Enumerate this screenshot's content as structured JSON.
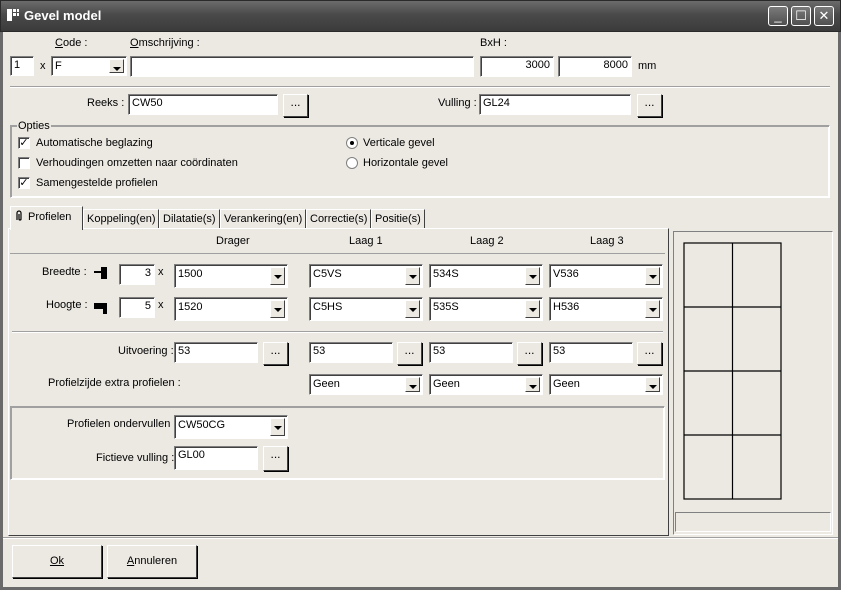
{
  "window": {
    "title": "Gevel model"
  },
  "header": {
    "count_value": "1",
    "times": "x",
    "code_label": "Code :",
    "code_value": "F",
    "omschrijving_label": "Omschrijving :",
    "omschrijving_value": "",
    "bxh_label": "BxH :",
    "breedte_value": "3000",
    "hoogte_value": "8000",
    "unit": "mm"
  },
  "reeks": {
    "label": "Reeks :",
    "value": "CW50",
    "button": "..."
  },
  "vulling": {
    "label": "Vulling :",
    "value": "GL24",
    "button": "..."
  },
  "opties": {
    "legend": "Opties",
    "auto_beglazing": {
      "label": "Automatische beglazing",
      "checked": true
    },
    "verhoudingen": {
      "label": "Verhoudingen omzetten naar coördinaten",
      "checked": false
    },
    "samengestelde": {
      "label": "Samengestelde profielen",
      "checked": true
    },
    "verticale": {
      "label": "Verticale gevel",
      "selected": true
    },
    "horizontale": {
      "label": "Horizontale gevel",
      "selected": false
    }
  },
  "tabs": [
    {
      "label": "Profielen",
      "active": true
    },
    {
      "label": "Koppeling(en)"
    },
    {
      "label": "Dilatatie(s)"
    },
    {
      "label": "Verankering(en)"
    },
    {
      "label": "Correctie(s)"
    },
    {
      "label": "Positie(s)"
    }
  ],
  "columns": {
    "drager": "Drager",
    "laag1": "Laag 1",
    "laag2": "Laag 2",
    "laag3": "Laag 3"
  },
  "breedte": {
    "label": "Breedte :",
    "count": "3",
    "times": "x",
    "drager": "1500",
    "laag1": "C5VS",
    "laag2": "534S",
    "laag3": "V536"
  },
  "hoogte": {
    "label": "Hoogte :",
    "count": "5",
    "times": "x",
    "drager": "1520",
    "laag1": "C5HS",
    "laag2": "535S",
    "laag3": "H536"
  },
  "uitvoering": {
    "label": "Uitvoering :",
    "drager": "53",
    "laag1": "53",
    "laag2": "53",
    "laag3": "53",
    "button": "..."
  },
  "profielzijde": {
    "label": "Profielzijde extra profielen :",
    "laag1": "Geen",
    "laag2": "Geen",
    "laag3": "Geen"
  },
  "ondervullen": {
    "label": "Profielen ondervullen :",
    "value": "CW50CG"
  },
  "fictieve": {
    "label": "Fictieve vulling :",
    "value": "GL00",
    "button": "..."
  },
  "preview": {
    "columns": 2,
    "rows": 4
  },
  "footer": {
    "ok": "Ok",
    "cancel": "Annuleren"
  }
}
